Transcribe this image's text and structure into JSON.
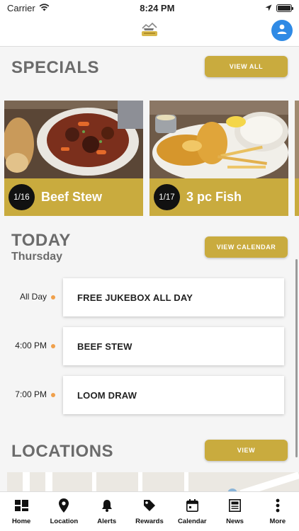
{
  "status_bar": {
    "carrier": "Carrier",
    "time": "8:24 PM"
  },
  "specials": {
    "title": "SPECIALS",
    "view_all_label": "VIEW ALL",
    "items": [
      {
        "date": "1/16",
        "name": "Beef Stew",
        "image": "beef-stew-photo"
      },
      {
        "date": "1/17",
        "name": "3 pc Fish",
        "image": "fish-and-chips-photo"
      }
    ]
  },
  "today": {
    "title": "TODAY",
    "day": "Thursday",
    "view_calendar_label": "VIEW CALENDAR",
    "events": [
      {
        "time": "All Day",
        "name": "FREE JUKEBOX ALL DAY"
      },
      {
        "time": "4:00 PM",
        "name": "BEEF STEW"
      },
      {
        "time": "7:00 PM",
        "name": "LOOM DRAW"
      }
    ]
  },
  "locations": {
    "title": "LOCATIONS",
    "view_label": "VIEW"
  },
  "tabs": [
    {
      "label": "Home",
      "icon": "dashboard-icon"
    },
    {
      "label": "Location",
      "icon": "map-pin-icon"
    },
    {
      "label": "Alerts",
      "icon": "bell-icon"
    },
    {
      "label": "Rewards",
      "icon": "tag-icon"
    },
    {
      "label": "Calendar",
      "icon": "calendar-icon"
    },
    {
      "label": "News",
      "icon": "newspaper-icon"
    },
    {
      "label": "More",
      "icon": "more-vertical-icon"
    }
  ],
  "colors": {
    "accent": "#c9ab3e",
    "profile": "#2f8ae5",
    "event_dot": "#f0a04b",
    "heading": "#6b6b6b"
  }
}
